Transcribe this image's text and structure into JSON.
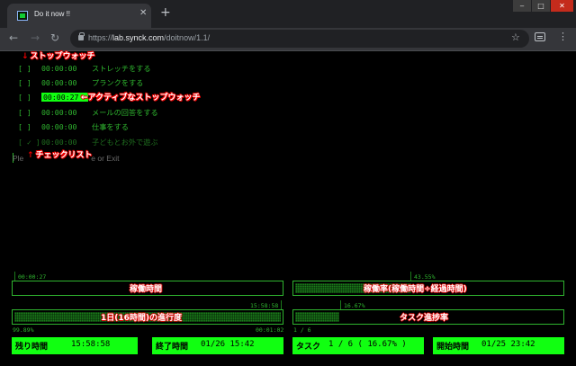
{
  "browser": {
    "tab_title": "Do it now !!",
    "url_scheme": "https://",
    "url_host": "lab.synck.com",
    "url_path": "/doitnow/1.1/",
    "tab_close": "✕",
    "new_tab": "+"
  },
  "annotations": {
    "stopwatch": "ストップウォッチ",
    "active_stopwatch": "←アクティブなストップウォッチ",
    "checklist": "チェックリスト"
  },
  "tasks": [
    {
      "check": "[  ]",
      "time": "00:00:00",
      "name": "ストレッチをする",
      "done": false,
      "active": false
    },
    {
      "check": "[  ]",
      "time": "00:00:00",
      "name": "プランクをする",
      "done": false,
      "active": false
    },
    {
      "check": "[  ]",
      "time": "00:00:27",
      "name": "",
      "done": false,
      "active": true
    },
    {
      "check": "[  ]",
      "time": "00:00:00",
      "name": "メールの回答をする",
      "done": false,
      "active": false
    },
    {
      "check": "[  ]",
      "time": "00:00:00",
      "name": "仕事をする",
      "done": false,
      "active": false
    },
    {
      "check": "[ ✓ ]",
      "time": "00:00:00",
      "name": "子どもとお外で遊ぶ",
      "done": true,
      "active": false
    }
  ],
  "prompt": {
    "left": "Ple",
    "right": "e or Exit"
  },
  "dashboard": {
    "work_time": {
      "value_text": "00:00:27",
      "label": "稼働時間",
      "fill_fraction": 0.0
    },
    "work_rate": {
      "value_text": "43.55%",
      "label": "稼働率(稼働時間÷経過時間)",
      "fill_fraction": 0.4355
    },
    "day_progress": {
      "value_text": "15:58:58",
      "label": "1日(16時間)の進行度",
      "left_text": "99.89%",
      "right_text": "00:01:02",
      "fill_fraction": 0.9989
    },
    "task_progress": {
      "value_text": "16.67%",
      "label": "タスク進捗率",
      "left_text": "1 / 6",
      "fill_fraction": 0.1667
    }
  },
  "stats": [
    {
      "key": "残り時間",
      "value": "15:58:58"
    },
    {
      "key": "終了時間",
      "value": "01/26 15:42"
    },
    {
      "key": "タスク",
      "value": "1 / 6 ( 16.67% )"
    },
    {
      "key": "開始時間",
      "value": "01/25 23:42"
    }
  ],
  "colors": {
    "terminal_green": "#2fb52f",
    "bright_green": "#11ff11",
    "annotation_red": "#e00000"
  }
}
